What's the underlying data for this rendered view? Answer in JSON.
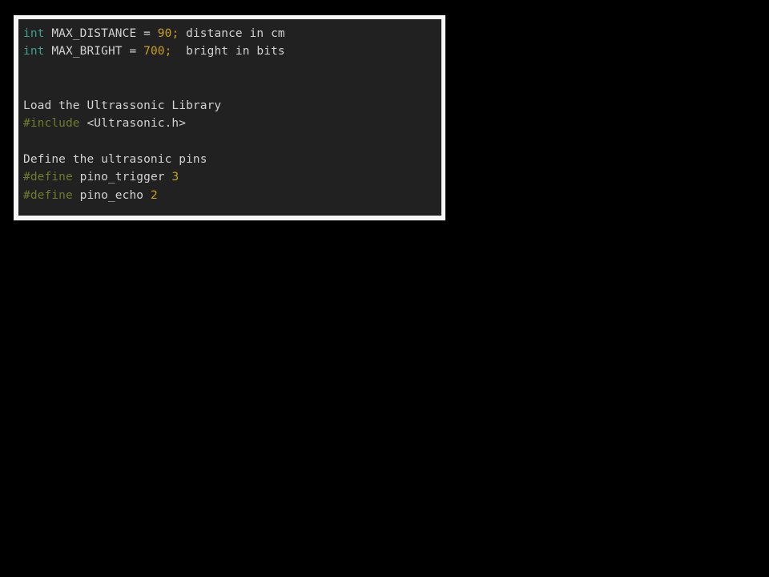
{
  "window": {
    "background_color": "#000000"
  },
  "code_panel": {
    "frame_color": "#f7f7f7",
    "surface_color": "#212121",
    "language": "arduino-c",
    "colors": {
      "keyword": "#3f9e8f",
      "number": "#c8a020",
      "punctuation": "#c8a020",
      "preprocessor": "#6e7c2c",
      "plain_text": "#d2d2d2"
    },
    "lines": [
      {
        "index": 1,
        "text": "int MAX_DISTANCE = 90; distance in cm",
        "tokens": [
          {
            "t": "int",
            "k": "keyword"
          },
          {
            "t": " MAX_DISTANCE = ",
            "k": "plain"
          },
          {
            "t": "90",
            "k": "number"
          },
          {
            "t": ";",
            "k": "punct"
          },
          {
            "t": " distance in cm",
            "k": "plain"
          }
        ]
      },
      {
        "index": 2,
        "text": "int MAX_BRIGHT = 700;  bright in bits",
        "tokens": [
          {
            "t": "int",
            "k": "keyword"
          },
          {
            "t": " MAX_BRIGHT = ",
            "k": "plain"
          },
          {
            "t": "700",
            "k": "number"
          },
          {
            "t": ";",
            "k": "punct"
          },
          {
            "t": "  bright in bits",
            "k": "plain"
          }
        ]
      },
      {
        "index": 3,
        "text": "",
        "tokens": []
      },
      {
        "index": 4,
        "text": "",
        "tokens": []
      },
      {
        "index": 5,
        "text": "Load the Ultrassonic Library",
        "tokens": [
          {
            "t": "Load the Ultrassonic Library",
            "k": "plain"
          }
        ]
      },
      {
        "index": 6,
        "text": "#include <Ultrasonic.h>",
        "tokens": [
          {
            "t": "#include",
            "k": "preproc"
          },
          {
            "t": " <Ultrasonic.h>",
            "k": "plain"
          }
        ]
      },
      {
        "index": 7,
        "text": "",
        "tokens": []
      },
      {
        "index": 8,
        "text": "Define the ultrasonic pins",
        "tokens": [
          {
            "t": "Define the ultrasonic pins",
            "k": "plain"
          }
        ]
      },
      {
        "index": 9,
        "text": "#define pino_trigger 3",
        "tokens": [
          {
            "t": "#define",
            "k": "preproc"
          },
          {
            "t": " pino_trigger ",
            "k": "plain"
          },
          {
            "t": "3",
            "k": "number"
          }
        ]
      },
      {
        "index": 10,
        "text": "#define pino_echo 2",
        "tokens": [
          {
            "t": "#define",
            "k": "preproc"
          },
          {
            "t": " pino_echo ",
            "k": "plain"
          },
          {
            "t": "2",
            "k": "number"
          }
        ]
      }
    ]
  }
}
